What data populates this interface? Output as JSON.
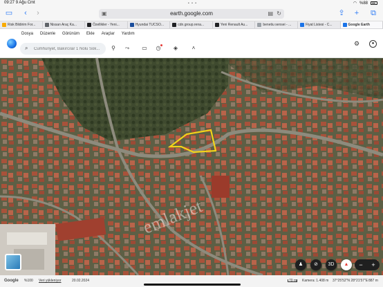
{
  "status_bar": {
    "time": "09:27",
    "date": "9 Ağu Cmt",
    "battery": "%88"
  },
  "browser": {
    "url": "earth.google.com",
    "tabs": [
      {
        "label": "Risk Bildirim For...",
        "color": "#f9ab00"
      },
      {
        "label": "Nissan Araç Ka...",
        "color": "#5f6368"
      },
      {
        "label": "Özellikler - Yeni...",
        "color": "#202124"
      },
      {
        "label": "Hyundai TUCSO...",
        "color": "#1a4d9c"
      },
      {
        "label": "cdn.group.rena...",
        "color": "#202124"
      },
      {
        "label": "Yeni Renault Au...",
        "color": "#202124"
      },
      {
        "label": "benetiu sensei - ...",
        "color": "#9aa0a6"
      },
      {
        "label": "Fiyat Listesi - C...",
        "color": "#1a73e8"
      },
      {
        "label": "Google Earth",
        "color": "#1a73e8"
      }
    ]
  },
  "earth": {
    "menu": [
      "Dosya",
      "Düzenle",
      "Görünüm",
      "Ekle",
      "Araçlar",
      "Yardım"
    ],
    "search_placeholder": "Cumhuriyet, Bakırcılar 1 Nolu Sok..."
  },
  "map": {
    "watermark": "emlakjet",
    "compass_label": "3D",
    "zoom_out": "−",
    "zoom_in": "+"
  },
  "footer": {
    "google": "Google",
    "zoom_level": "%100",
    "status": "Veri yükleniyor",
    "date": "20.02.2024",
    "scale_label": "70 m",
    "camera": "Kamera: 1.408 m",
    "coords": "37°25'52\"N 28°21'57\"E",
    "elevation": "887 m"
  }
}
